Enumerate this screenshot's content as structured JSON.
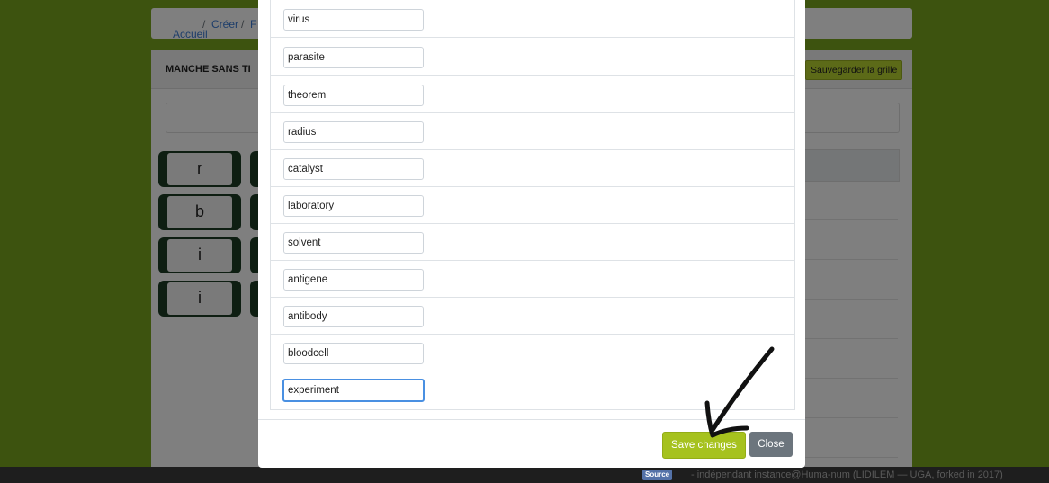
{
  "background": {
    "breadcrumb": [
      "Accueil",
      "/",
      "Créer",
      "/",
      "F"
    ],
    "panel_title": "MANCHE SANS TI",
    "save_grid_label": "Sauvegarder la grille",
    "letters": [
      "r",
      "b",
      "i",
      "i"
    ]
  },
  "modal": {
    "words": [
      "virus",
      "parasite",
      "theorem",
      "radius",
      "catalyst",
      "laboratory",
      "solvent",
      "antigene",
      "antibody",
      "bloodcell",
      "experiment"
    ],
    "save_label": "Save changes",
    "close_label": "Close"
  },
  "footer": {
    "badge": "Source",
    "text": "- indépendant instance@Huma-num (LIDILEM — UGA, forked in 2017)"
  },
  "colors": {
    "accent": "#a6c21e",
    "page_bg": "#7ba71f",
    "close_btn": "#6c757d"
  },
  "annotation": {
    "icon": "hand-drawn-arrow-icon"
  }
}
